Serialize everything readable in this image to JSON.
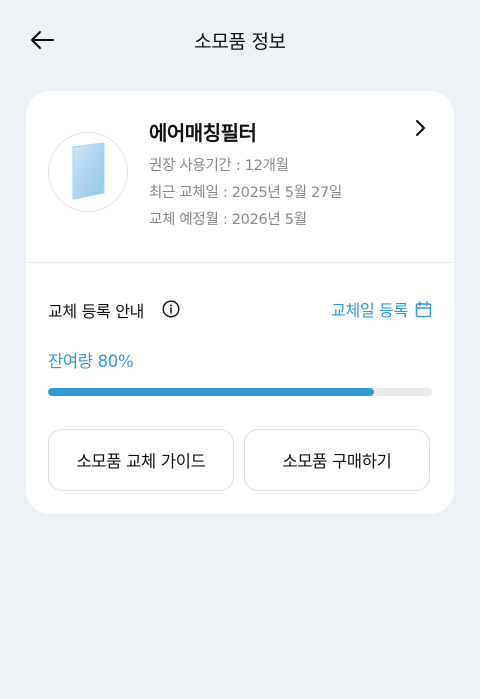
{
  "header": {
    "title": "소모품 정보",
    "back_icon": "arrow-left-icon"
  },
  "product": {
    "name": "에어매칭필터",
    "recommended_period": "권장 사용기간 : 12개월",
    "last_replaced": "최근 교체일 : 2025년 5월 27일",
    "next_replacement": "교체 예정월 : 2026년 5월"
  },
  "replacement": {
    "label": "교체 등록 안내",
    "register_label": "교체일 등록",
    "remaining_label": "잔여량 80%",
    "remaining_fraction": 0.85,
    "accent": "#2e9bd6"
  },
  "buttons": {
    "guide": "소모품 교체 가이드",
    "buy": "소모품 구매하기"
  }
}
